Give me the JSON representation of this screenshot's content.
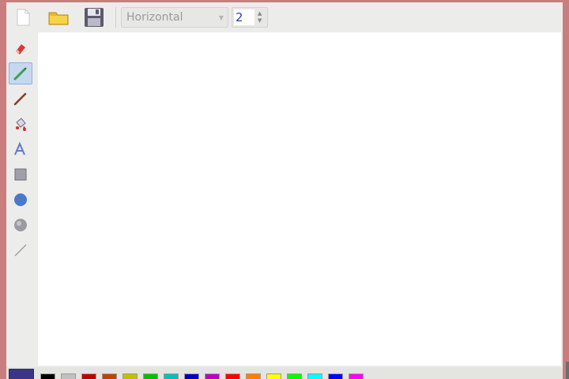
{
  "toolbar": {
    "orientation": {
      "value": "Horizontal"
    },
    "line_width": {
      "value": "2"
    }
  },
  "icons": {
    "new": "new-document-icon",
    "open": "open-folder-icon",
    "save": "save-floppy-icon"
  },
  "tools": [
    {
      "name": "eraser-tool",
      "active": false
    },
    {
      "name": "pencil-tool",
      "active": true
    },
    {
      "name": "line-tool",
      "active": false
    },
    {
      "name": "fill-tool",
      "active": false
    },
    {
      "name": "text-tool",
      "active": false
    },
    {
      "name": "rectangle-tool",
      "active": false
    },
    {
      "name": "ellipse-tool",
      "active": false
    },
    {
      "name": "rounded-shape-tool",
      "active": false
    },
    {
      "name": "thin-line-tool",
      "active": false
    }
  ],
  "palette": {
    "current_color": "#3c3486",
    "colors": [
      "#000000",
      "#c0c0c0",
      "#c00000",
      "#c04000",
      "#c0c000",
      "#00c000",
      "#00c0c0",
      "#0000c0",
      "#c000c0",
      "#ff0000",
      "#ff8000",
      "#ffff00",
      "#00ff00",
      "#00ffff",
      "#0000ff",
      "#ff00ff"
    ]
  },
  "colors": {
    "window_border": "#c97d7d",
    "active_tool": "#c6d8f0",
    "canvas": "#ffffff"
  }
}
